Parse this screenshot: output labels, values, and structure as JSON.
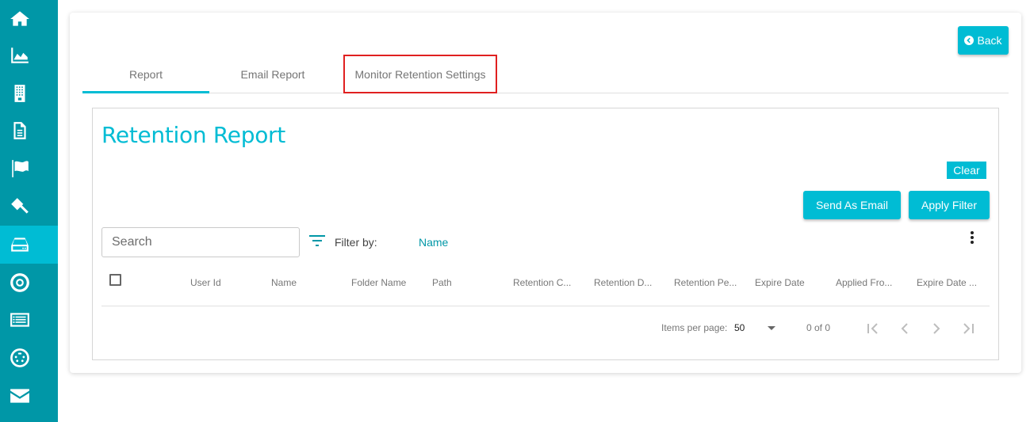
{
  "sidebar": {
    "items": [
      {
        "icon": "home-icon",
        "label": "Home",
        "active": false
      },
      {
        "icon": "area-chart-icon",
        "label": "Analytics",
        "active": false
      },
      {
        "icon": "building-icon",
        "label": "Organization",
        "active": false
      },
      {
        "icon": "document-icon",
        "label": "Documents",
        "active": false
      },
      {
        "icon": "flag-icon",
        "label": "Flags",
        "active": false
      },
      {
        "icon": "gavel-icon",
        "label": "Legal",
        "active": false
      },
      {
        "icon": "hard-drive-icon",
        "label": "Retention",
        "active": true
      },
      {
        "icon": "life-ring-icon",
        "label": "Support",
        "active": false
      },
      {
        "icon": "list-icon",
        "label": "Lists",
        "active": false
      },
      {
        "icon": "settings-circle-icon",
        "label": "Settings",
        "active": false
      },
      {
        "icon": "envelope-icon",
        "label": "Mail",
        "active": false
      }
    ]
  },
  "header": {
    "back_label": "Back"
  },
  "tabs": [
    {
      "label": "Report",
      "active": true
    },
    {
      "label": "Email Report",
      "active": false
    },
    {
      "label": "Monitor Retention Settings",
      "active": false,
      "highlighted": true
    }
  ],
  "report": {
    "title": "Retention Report",
    "clear_label": "Clear",
    "send_email_label": "Send As Email",
    "apply_filter_label": "Apply Filter",
    "search": {
      "placeholder": "Search",
      "value": ""
    },
    "filter_by_label": "Filter by:",
    "filter_by_value": "Name",
    "columns": [
      "User Id",
      "Name",
      "Folder Name",
      "Path",
      "Retention C...",
      "Retention D...",
      "Retention Pe...",
      "Expire Date",
      "Applied Fro...",
      "Expire Date ..."
    ],
    "rows": []
  },
  "paginator": {
    "items_per_page_label": "Items per page:",
    "page_size": "50",
    "range_label": "0 of 0"
  },
  "colors": {
    "sidebar_bg": "#0097a7",
    "sidebar_active": "#00bcd4",
    "accent": "#00bcd4",
    "highlight_outline": "#e02020"
  }
}
